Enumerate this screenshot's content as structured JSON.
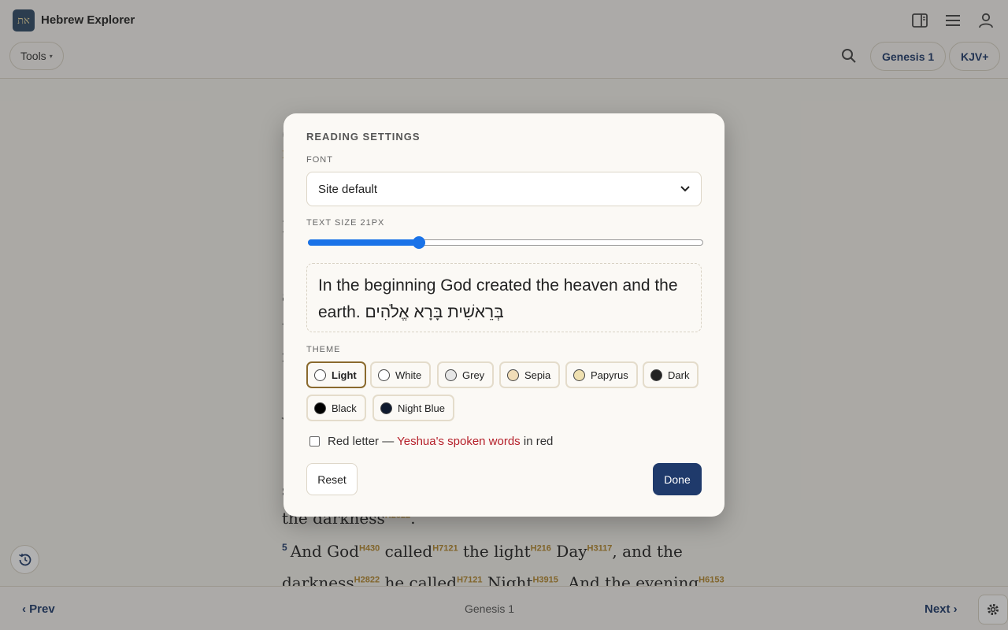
{
  "header": {
    "logo_text": "את",
    "app_title": "Hebrew Explorer",
    "tools_label": "Tools",
    "tools_caret": "▾",
    "chapter_pill": "Genesis 1",
    "version_pill": "KJV+"
  },
  "reading": {
    "line1": {
      "strongs_a": "H2822"
    },
    "verse5": {
      "num": "5",
      "w1": "And God",
      "s1": "H430",
      "w2": "called",
      "s2": "H7121",
      "w3": "the light",
      "s3": "H216",
      "w4": "Day",
      "s4": "H3117",
      "w5": ", and the"
    },
    "line2": {
      "w1": "darkness",
      "s1": "H2822",
      "w2": "he called",
      "s2": "H7121",
      "w3": "Night",
      "s3": "H3915",
      "w4": ". And the evening",
      "s4": "H6153"
    },
    "partial": {
      "darkness_line": "the darkness",
      "darkness_punct": "."
    }
  },
  "footer": {
    "prev_label": "‹ Prev",
    "next_label": "Next ›",
    "chapter_ref": "Genesis 1"
  },
  "modal": {
    "title": "READING SETTINGS",
    "font_label": "FONT",
    "font_value": "Site default",
    "text_size_label": "TEXT SIZE 21PX",
    "text_size_px": 21,
    "text_size_min": 12,
    "text_size_max": 44,
    "preview_text": "In the beginning God created the heaven and the earth. בְּרֵאשִׁית בָּרָא אֱלֹהִים",
    "theme_label": "THEME",
    "themes": [
      {
        "label": "Light",
        "color": "#ffffff",
        "active": true
      },
      {
        "label": "White",
        "color": "#ffffff",
        "active": false
      },
      {
        "label": "Grey",
        "color": "#e6e6e6",
        "active": false
      },
      {
        "label": "Sepia",
        "color": "#f1ddb8",
        "active": false
      },
      {
        "label": "Papyrus",
        "color": "#efe0b0",
        "active": false
      },
      {
        "label": "Dark",
        "color": "#222222",
        "active": false
      },
      {
        "label": "Black",
        "color": "#000000",
        "active": false
      },
      {
        "label": "Night Blue",
        "color": "#0f1a2e",
        "active": false
      }
    ],
    "red_letter_label": "Red letter —",
    "red_letter_highlight": "Yeshua's spoken words",
    "red_letter_suffix": "in red",
    "red_letter_checked": false,
    "reset_label": "Reset",
    "done_label": "Done"
  }
}
